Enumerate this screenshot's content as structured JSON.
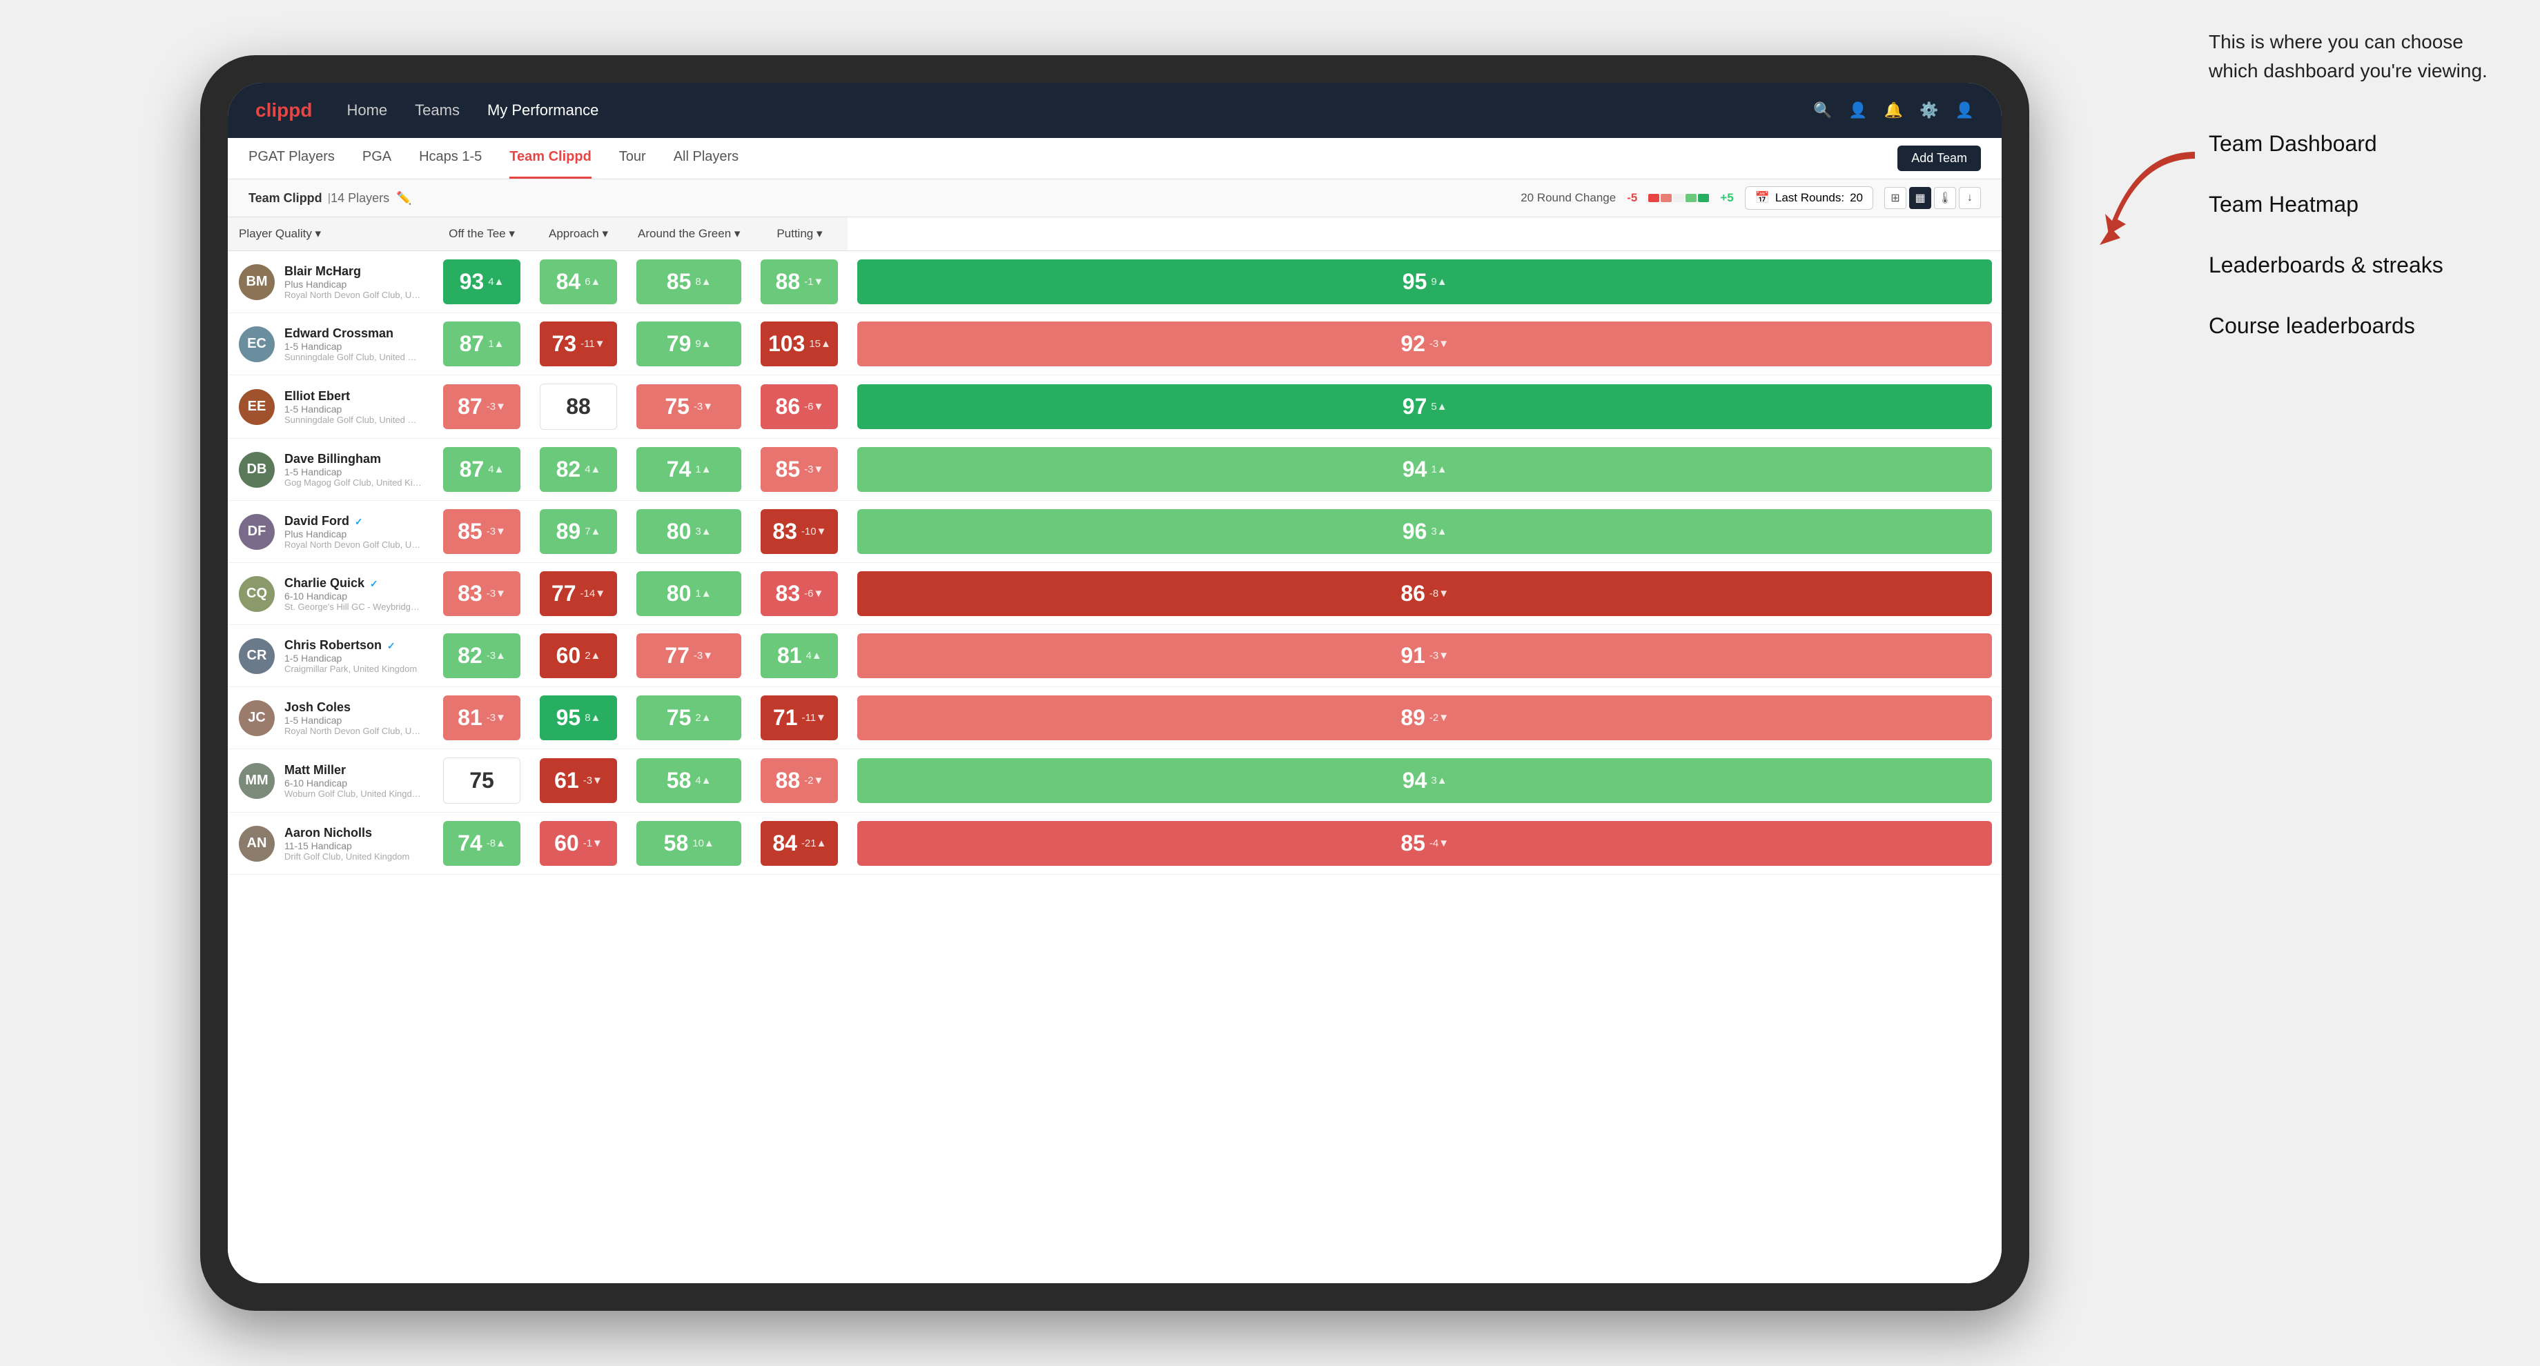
{
  "annotation": {
    "intro": "This is where you can choose which dashboard you're viewing.",
    "items": [
      "Team Dashboard",
      "Team Heatmap",
      "Leaderboards & streaks",
      "Course leaderboards"
    ]
  },
  "nav": {
    "logo": "clippd",
    "links": [
      "Home",
      "Teams",
      "My Performance"
    ],
    "active_link": "My Performance"
  },
  "tabs": {
    "items": [
      "PGAT Players",
      "PGA",
      "Hcaps 1-5",
      "Team Clippd",
      "Tour",
      "All Players"
    ],
    "active": "Team Clippd",
    "add_button": "Add Team"
  },
  "sub_header": {
    "title": "Team Clippd",
    "count": "14 Players",
    "round_change_label": "20 Round Change",
    "round_neg": "-5",
    "round_pos": "+5",
    "last_rounds_label": "Last Rounds:",
    "last_rounds_value": "20"
  },
  "table": {
    "headers": {
      "player": "Player Quality",
      "off_tee": "Off the Tee",
      "approach": "Approach",
      "around_green": "Around the Green",
      "putting": "Putting"
    },
    "players": [
      {
        "name": "Blair McHarg",
        "handicap": "Plus Handicap",
        "club": "Royal North Devon Golf Club, United Kingdom",
        "avatar_color": "#8B7355",
        "initials": "BM",
        "player_quality": {
          "value": 93,
          "delta": "4▲",
          "color": "green-dark"
        },
        "off_tee": {
          "value": 84,
          "delta": "6▲",
          "color": "green-light"
        },
        "approach": {
          "value": 85,
          "delta": "8▲",
          "color": "green-light"
        },
        "around_green": {
          "value": 88,
          "delta": "-1▼",
          "color": "green-light"
        },
        "putting": {
          "value": 95,
          "delta": "9▲",
          "color": "green-dark"
        }
      },
      {
        "name": "Edward Crossman",
        "handicap": "1-5 Handicap",
        "club": "Sunningdale Golf Club, United Kingdom",
        "avatar_color": "#6B8E9F",
        "initials": "EC",
        "player_quality": {
          "value": 87,
          "delta": "1▲",
          "color": "green-light"
        },
        "off_tee": {
          "value": 73,
          "delta": "-11▼",
          "color": "red-dark"
        },
        "approach": {
          "value": 79,
          "delta": "9▲",
          "color": "green-light"
        },
        "around_green": {
          "value": 103,
          "delta": "15▲",
          "color": "red-dark"
        },
        "putting": {
          "value": 92,
          "delta": "-3▼",
          "color": "red-light"
        }
      },
      {
        "name": "Elliot Ebert",
        "handicap": "1-5 Handicap",
        "club": "Sunningdale Golf Club, United Kingdom",
        "avatar_color": "#A0522D",
        "initials": "EE",
        "player_quality": {
          "value": 87,
          "delta": "-3▼",
          "color": "red-light"
        },
        "off_tee": {
          "value": 88,
          "delta": "",
          "color": "neutral"
        },
        "approach": {
          "value": 75,
          "delta": "-3▼",
          "color": "red-light"
        },
        "around_green": {
          "value": 86,
          "delta": "-6▼",
          "color": "red-mid"
        },
        "putting": {
          "value": 97,
          "delta": "5▲",
          "color": "green-dark"
        }
      },
      {
        "name": "Dave Billingham",
        "handicap": "1-5 Handicap",
        "club": "Gog Magog Golf Club, United Kingdom",
        "avatar_color": "#5A7A5A",
        "initials": "DB",
        "player_quality": {
          "value": 87,
          "delta": "4▲",
          "color": "green-light"
        },
        "off_tee": {
          "value": 82,
          "delta": "4▲",
          "color": "green-light"
        },
        "approach": {
          "value": 74,
          "delta": "1▲",
          "color": "green-light"
        },
        "around_green": {
          "value": 85,
          "delta": "-3▼",
          "color": "red-light"
        },
        "putting": {
          "value": 94,
          "delta": "1▲",
          "color": "green-light"
        }
      },
      {
        "name": "David Ford",
        "handicap": "Plus Handicap",
        "club": "Royal North Devon Golf Club, United Kingdom",
        "avatar_color": "#7B6B8A",
        "initials": "DF",
        "verified": true,
        "player_quality": {
          "value": 85,
          "delta": "-3▼",
          "color": "red-light"
        },
        "off_tee": {
          "value": 89,
          "delta": "7▲",
          "color": "green-light"
        },
        "approach": {
          "value": 80,
          "delta": "3▲",
          "color": "green-light"
        },
        "around_green": {
          "value": 83,
          "delta": "-10▼",
          "color": "red-dark"
        },
        "putting": {
          "value": 96,
          "delta": "3▲",
          "color": "green-light"
        }
      },
      {
        "name": "Charlie Quick",
        "handicap": "6-10 Handicap",
        "club": "St. George's Hill GC - Weybridge - Surrey, Uni...",
        "avatar_color": "#8B9A6B",
        "initials": "CQ",
        "verified": true,
        "player_quality": {
          "value": 83,
          "delta": "-3▼",
          "color": "red-light"
        },
        "off_tee": {
          "value": 77,
          "delta": "-14▼",
          "color": "red-dark"
        },
        "approach": {
          "value": 80,
          "delta": "1▲",
          "color": "green-light"
        },
        "around_green": {
          "value": 83,
          "delta": "-6▼",
          "color": "red-mid"
        },
        "putting": {
          "value": 86,
          "delta": "-8▼",
          "color": "red-dark"
        }
      },
      {
        "name": "Chris Robertson",
        "handicap": "1-5 Handicap",
        "club": "Craigmillar Park, United Kingdom",
        "avatar_color": "#6B7A8B",
        "initials": "CR",
        "verified": true,
        "player_quality": {
          "value": 82,
          "delta": "-3▲",
          "color": "green-light"
        },
        "off_tee": {
          "value": 60,
          "delta": "2▲",
          "color": "red-dark"
        },
        "approach": {
          "value": 77,
          "delta": "-3▼",
          "color": "red-light"
        },
        "around_green": {
          "value": 81,
          "delta": "4▲",
          "color": "green-light"
        },
        "putting": {
          "value": 91,
          "delta": "-3▼",
          "color": "red-light"
        }
      },
      {
        "name": "Josh Coles",
        "handicap": "1-5 Handicap",
        "club": "Royal North Devon Golf Club, United Kingdom",
        "avatar_color": "#9B7B6B",
        "initials": "JC",
        "player_quality": {
          "value": 81,
          "delta": "-3▼",
          "color": "red-light"
        },
        "off_tee": {
          "value": 95,
          "delta": "8▲",
          "color": "green-dark"
        },
        "approach": {
          "value": 75,
          "delta": "2▲",
          "color": "green-light"
        },
        "around_green": {
          "value": 71,
          "delta": "-11▼",
          "color": "red-dark"
        },
        "putting": {
          "value": 89,
          "delta": "-2▼",
          "color": "red-light"
        }
      },
      {
        "name": "Matt Miller",
        "handicap": "6-10 Handicap",
        "club": "Woburn Golf Club, United Kingdom",
        "avatar_color": "#7A8B7A",
        "initials": "MM",
        "player_quality": {
          "value": 75,
          "delta": "",
          "color": "neutral"
        },
        "off_tee": {
          "value": 61,
          "delta": "-3▼",
          "color": "red-dark"
        },
        "approach": {
          "value": 58,
          "delta": "4▲",
          "color": "green-light"
        },
        "around_green": {
          "value": 88,
          "delta": "-2▼",
          "color": "red-light"
        },
        "putting": {
          "value": 94,
          "delta": "3▲",
          "color": "green-light"
        }
      },
      {
        "name": "Aaron Nicholls",
        "handicap": "11-15 Handicap",
        "club": "Drift Golf Club, United Kingdom",
        "avatar_color": "#8A7B6A",
        "initials": "AN",
        "player_quality": {
          "value": 74,
          "delta": "-8▲",
          "color": "green-light"
        },
        "off_tee": {
          "value": 60,
          "delta": "-1▼",
          "color": "red-mid"
        },
        "approach": {
          "value": 58,
          "delta": "10▲",
          "color": "green-light"
        },
        "around_green": {
          "value": 84,
          "delta": "-21▲",
          "color": "red-dark"
        },
        "putting": {
          "value": 85,
          "delta": "-4▼",
          "color": "red-mid"
        }
      }
    ]
  }
}
